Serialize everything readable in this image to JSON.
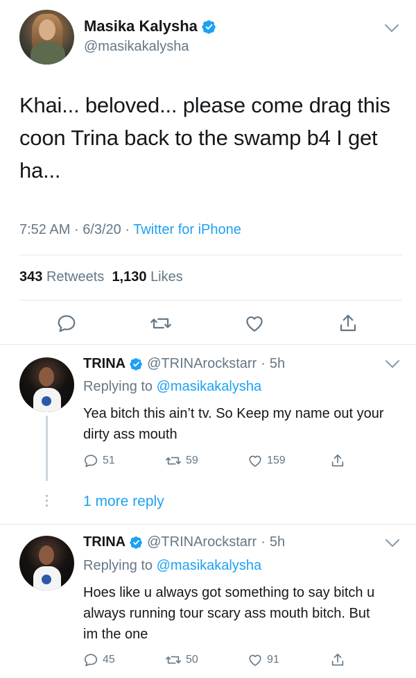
{
  "main_tweet": {
    "name": "Masika Kalysha",
    "handle": "@masikakalysha",
    "text": "Khai... beloved... please come drag this coon Trina back to the swamp b4 I get ha...",
    "time": "7:52 AM",
    "date": "6/3/20",
    "source": "Twitter for iPhone",
    "retweets": "343",
    "retweets_label": "Retweets",
    "likes": "1,130",
    "likes_label": "Likes"
  },
  "replies": [
    {
      "name": "TRINA",
      "handle": "@TRINArockstarr",
      "age": "5h",
      "replying_label": "Replying to",
      "replying_to": "@masikakalysha",
      "text": "Yea bitch this ain’t tv. So Keep my name out your dirty ass mouth",
      "reply_count": "51",
      "retweet_count": "59",
      "like_count": "159"
    },
    {
      "name": "TRINA",
      "handle": "@TRINArockstarr",
      "age": "5h",
      "replying_label": "Replying to",
      "replying_to": "@masikakalysha",
      "text": "Hoes like u always got something to say bitch u always running tour scary ass mouth bitch. But im the one",
      "reply_count": "45",
      "retweet_count": "50",
      "like_count": "91"
    }
  ],
  "more_replies_label": "1 more reply",
  "separator": "·",
  "colors": {
    "accent": "#1da1f2",
    "muted": "#657786",
    "text": "#14171a",
    "border": "#e1e8ed"
  },
  "icons": [
    "verified-badge-icon",
    "chevron-down-icon",
    "reply-icon",
    "retweet-icon",
    "like-icon",
    "share-icon"
  ]
}
